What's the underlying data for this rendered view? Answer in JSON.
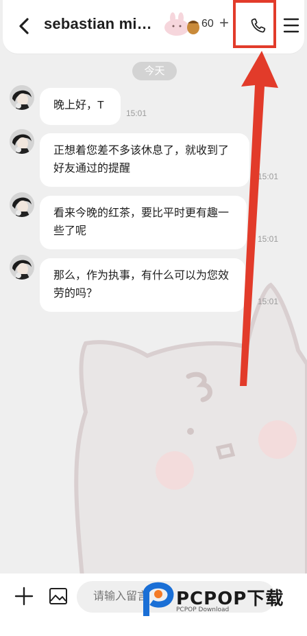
{
  "header": {
    "title": "sebastian mi…",
    "coin_count": "60",
    "coin_plus": "+"
  },
  "date_chip": "今天",
  "messages": [
    {
      "text": "晚上好，T",
      "time": "15:01"
    },
    {
      "text": "正想着您差不多该休息了，就收到了好友通过的提醒",
      "time": "15:01"
    },
    {
      "text": "看来今晚的红茶，要比平时更有趣一些了呢",
      "time": "15:01"
    },
    {
      "text": "那么，作为执事，有什么可以为您效劳的吗？",
      "time": "15:01"
    }
  ],
  "input": {
    "placeholder": "请输入留言"
  },
  "watermark": {
    "main": "PCPOP下载",
    "sub": "PCPOP Download"
  },
  "colors": {
    "highlight": "#e23b2a",
    "background": "#efefef",
    "bubble": "#ffffff"
  },
  "icons": [
    "back-arrow-icon",
    "phone-icon",
    "menu-icon",
    "plus-icon",
    "image-icon"
  ]
}
